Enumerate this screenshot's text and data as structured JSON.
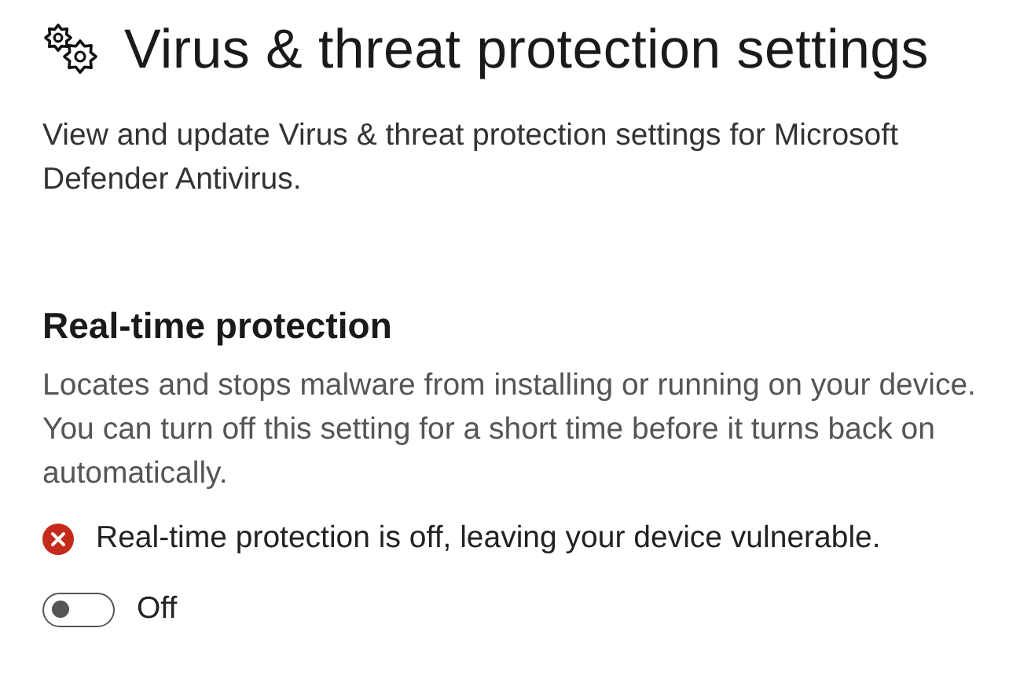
{
  "page": {
    "title": "Virus & threat protection settings",
    "description": "View and update Virus & threat protection settings for Microsoft Defender Antivirus."
  },
  "section": {
    "heading": "Real-time protection",
    "description": "Locates and stops malware from installing or running on your device. You can turn off this setting for a short time before it turns back on automatically.",
    "alert": {
      "kind": "error",
      "text": "Real-time protection is off, leaving your device vulnerable."
    },
    "toggle": {
      "on": false,
      "label": "Off"
    }
  }
}
